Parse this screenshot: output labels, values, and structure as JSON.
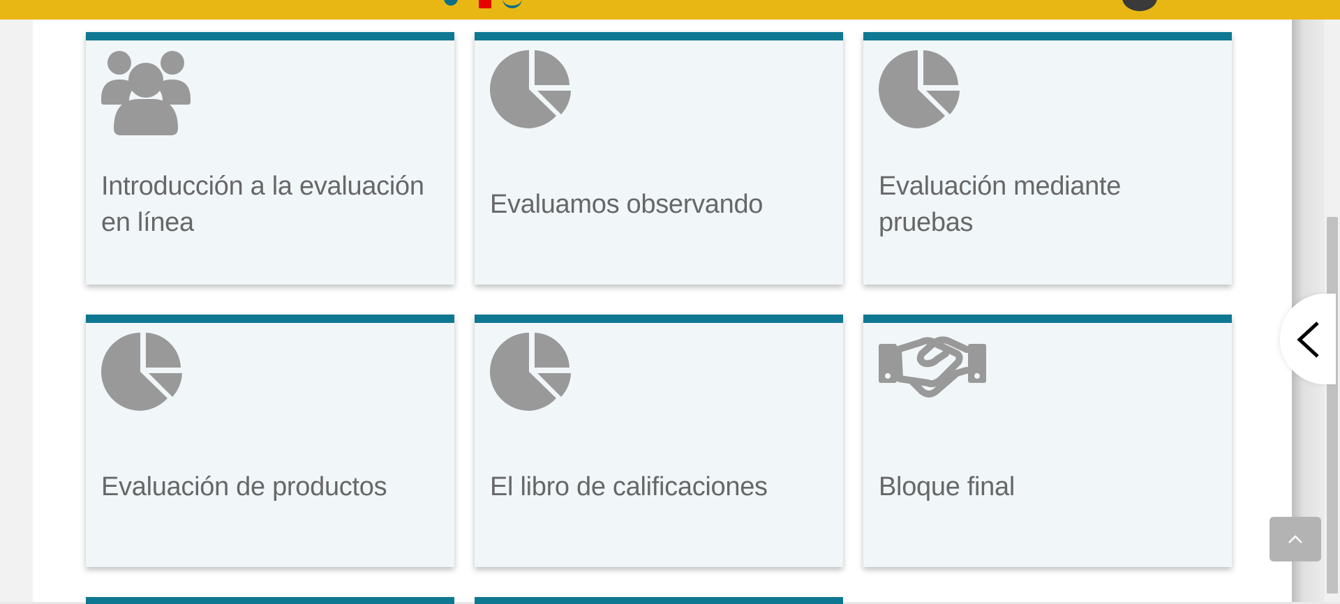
{
  "topbar": {
    "color": "#e9b714",
    "icons": [
      "bell-icon",
      "notification-badge",
      "chat-icon",
      "user-avatar"
    ]
  },
  "cards": [
    {
      "title": "Introducción a la evaluación en línea",
      "icon": "users-icon"
    },
    {
      "title": "Evaluamos observando",
      "icon": "pie-chart-icon"
    },
    {
      "title": "Evaluación mediante pruebas",
      "icon": "pie-chart-icon"
    },
    {
      "title": "Evaluación de productos",
      "icon": "pie-chart-icon"
    },
    {
      "title": "El libro de calificaciones",
      "icon": "pie-chart-icon"
    },
    {
      "title": "Bloque final",
      "icon": "handshake-icon"
    }
  ],
  "colors": {
    "card_accent": "#0e7892",
    "card_bg": "#f1f6f9",
    "icon": "#999999",
    "title_text": "#676767"
  },
  "controls": {
    "side_toggle_icon": "chevron-left-icon",
    "back_to_top_icon": "chevron-up-icon"
  }
}
